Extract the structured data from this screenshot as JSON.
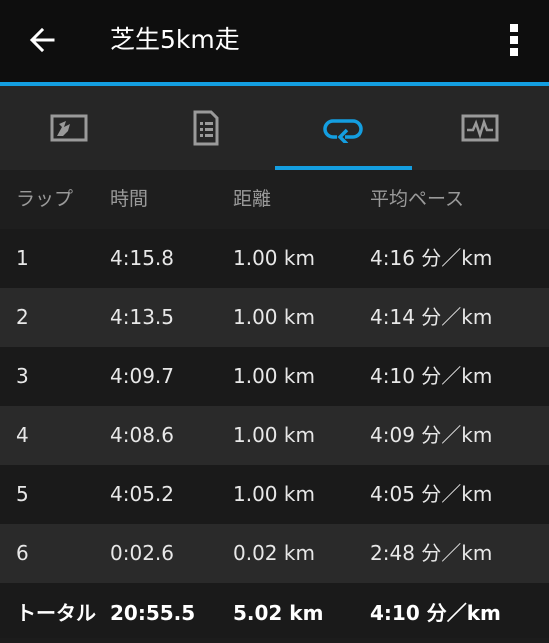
{
  "appbar": {
    "title": "芝生5km走",
    "back_icon": "arrow-left-icon",
    "menu_icon": "more-vert-icon"
  },
  "colors": {
    "accent": "#149ee0",
    "appbar_bg": "#0e0e0e",
    "tab_bg": "#262626",
    "row_dark": "#1a1a1a",
    "row_light": "#2a2a2a"
  },
  "tabs": [
    {
      "icon": "map-icon",
      "active": false
    },
    {
      "icon": "document-list-icon",
      "active": false
    },
    {
      "icon": "laps-loop-icon",
      "active": true
    },
    {
      "icon": "activity-chart-icon",
      "active": false
    }
  ],
  "table": {
    "headers": {
      "lap": "ラップ",
      "time": "時間",
      "distance": "距離",
      "pace": "平均ペース"
    },
    "rows": [
      {
        "lap": "1",
        "time": "4:15.8",
        "distance": "1.00 km",
        "pace": "4:16 分／km"
      },
      {
        "lap": "2",
        "time": "4:13.5",
        "distance": "1.00 km",
        "pace": "4:14 分／km"
      },
      {
        "lap": "3",
        "time": "4:09.7",
        "distance": "1.00 km",
        "pace": "4:10 分／km"
      },
      {
        "lap": "4",
        "time": "4:08.6",
        "distance": "1.00 km",
        "pace": "4:09 分／km"
      },
      {
        "lap": "5",
        "time": "4:05.2",
        "distance": "1.00 km",
        "pace": "4:05 分／km"
      },
      {
        "lap": "6",
        "time": "0:02.6",
        "distance": "0.02 km",
        "pace": "2:48 分／km"
      }
    ],
    "total": {
      "lap": "トータル",
      "time": "20:55.5",
      "distance": "5.02 km",
      "pace": "4:10 分／km"
    }
  }
}
